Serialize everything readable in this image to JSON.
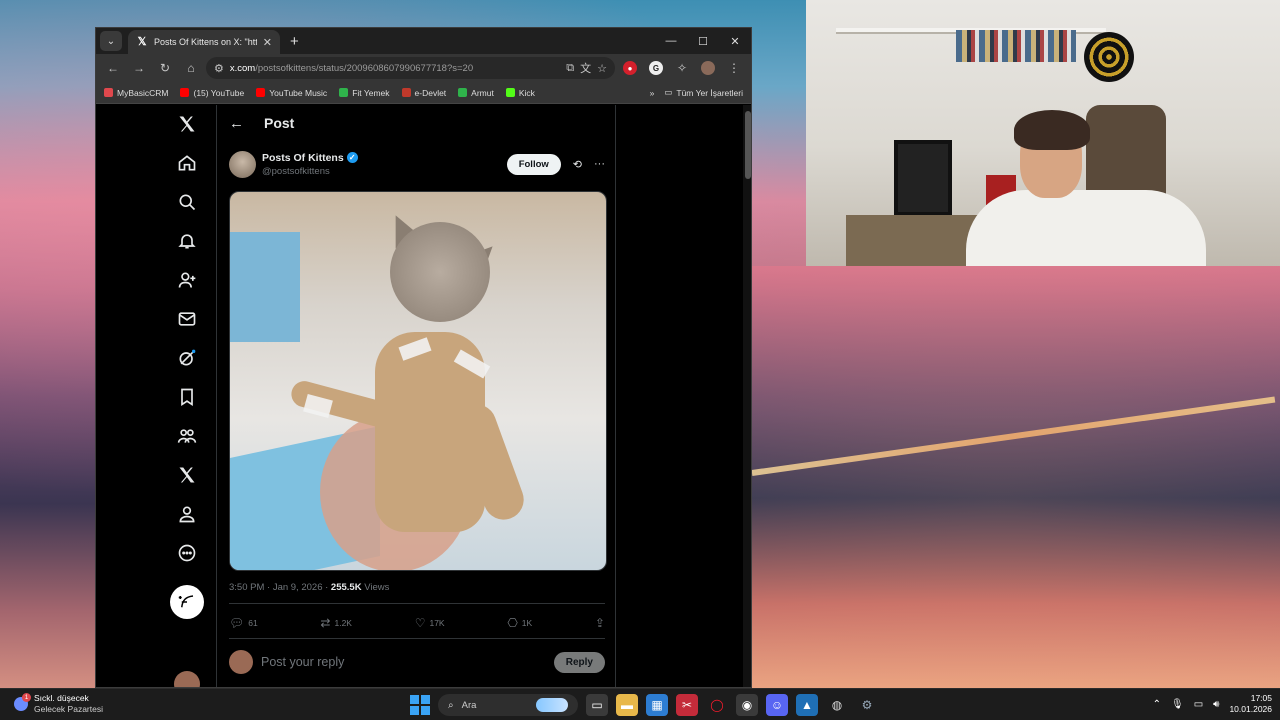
{
  "browser": {
    "tab_title": "Posts Of Kittens on X: \"https://t",
    "url_host": "x.com",
    "url_rest": "/postsofkittens/status/2009608607990677718?s=20",
    "bookmarks": [
      {
        "label": "MyBasicCRM",
        "color": "#e0484d"
      },
      {
        "label": "(15) YouTube",
        "color": "#ff0000"
      },
      {
        "label": "YouTube Music",
        "color": "#ff0000"
      },
      {
        "label": "Fit Yemek",
        "color": "#2fb34b"
      },
      {
        "label": "e-Devlet",
        "color": "#c0392b"
      },
      {
        "label": "Armut",
        "color": "#2fb34b"
      },
      {
        "label": "Kick",
        "color": "#53fc18"
      }
    ],
    "all_bookmarks_label": "Tüm Yer İşaretleri",
    "more_bookmarks": "»"
  },
  "x": {
    "header_title": "Post",
    "author": {
      "name": "Posts Of Kittens",
      "handle": "@postsofkittens"
    },
    "follow_label": "Follow",
    "meta": {
      "time": "3:50 PM · Jan 9, 2026 · ",
      "views_count": "255.5K",
      "views_label": " Views"
    },
    "actions": {
      "replies": "61",
      "reposts": "1.2K",
      "likes": "17K",
      "bookmarks": "1K"
    },
    "reply_placeholder": "Post your reply",
    "reply_label": "Reply"
  },
  "taskbar": {
    "weather_title": "Sıckl. düşecek",
    "weather_sub": "Gelecek Pazartesi",
    "weather_badge": "1",
    "search_label": "Ara",
    "time": "17:05",
    "date": "10.01.2026"
  }
}
